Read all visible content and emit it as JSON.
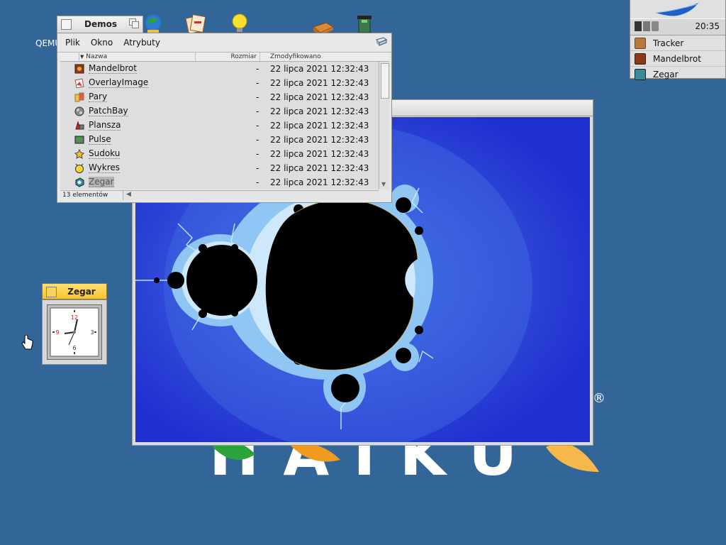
{
  "desktop": {
    "qemu_label": "QEMU",
    "brand_text": "HAIKU",
    "registered": "®"
  },
  "deskbar": {
    "clock": "20:35",
    "apps": [
      {
        "label": "Tracker"
      },
      {
        "label": "Mandelbrot"
      },
      {
        "label": "Zegar"
      }
    ]
  },
  "demos_window": {
    "title": "Demos",
    "menu": [
      "Plik",
      "Okno",
      "Atrybuty"
    ],
    "columns": {
      "name": "Nazwa",
      "size": "Rozmiar",
      "modified": "Zmodyfikowano"
    },
    "rows": [
      {
        "name": "Mandelbrot",
        "size": "-",
        "modified": "22 lipca 2021 12:32:43"
      },
      {
        "name": "OverlayImage",
        "size": "-",
        "modified": "22 lipca 2021 12:32:43"
      },
      {
        "name": "Pary",
        "size": "-",
        "modified": "22 lipca 2021 12:32:43"
      },
      {
        "name": "PatchBay",
        "size": "-",
        "modified": "22 lipca 2021 12:32:43"
      },
      {
        "name": "Plansza",
        "size": "-",
        "modified": "22 lipca 2021 12:32:43"
      },
      {
        "name": "Pulse",
        "size": "-",
        "modified": "22 lipca 2021 12:32:43"
      },
      {
        "name": "Sudoku",
        "size": "-",
        "modified": "22 lipca 2021 12:32:43"
      },
      {
        "name": "Wykres",
        "size": "-",
        "modified": "22 lipca 2021 12:32:43"
      },
      {
        "name": "Zegar",
        "size": "-",
        "modified": "22 lipca 2021 12:32:43"
      }
    ],
    "status": "13 elementów"
  },
  "zegar_window": {
    "title": "Zegar",
    "numerals": [
      "12",
      "3",
      "6",
      "9"
    ]
  },
  "colors": {
    "desktop": "#336698",
    "active_tab": "#f6c42b",
    "fractal_bg": "#1e2fd0"
  }
}
